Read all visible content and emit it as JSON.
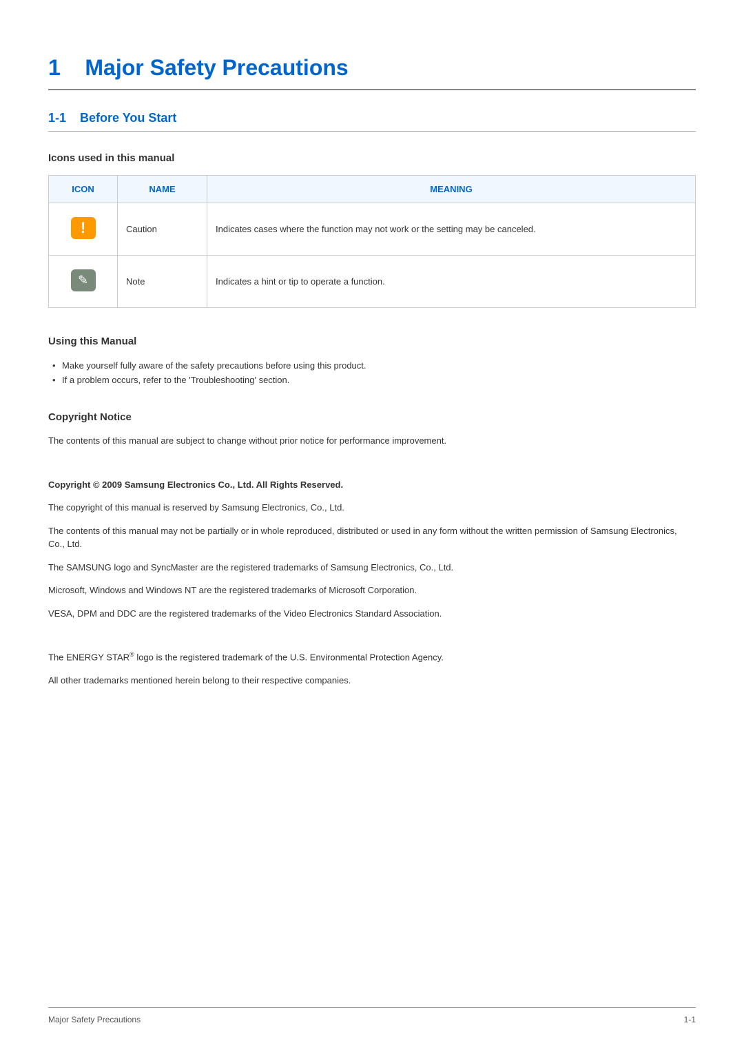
{
  "chapter": {
    "number": "1",
    "title": "Major Safety Precautions"
  },
  "section": {
    "number": "1-1",
    "title": "Before You Start"
  },
  "iconsHeading": "Icons used in this manual",
  "table": {
    "headers": {
      "icon": "ICON",
      "name": "NAME",
      "meaning": "MEANING"
    },
    "rows": [
      {
        "name": "Caution",
        "meaning": "Indicates cases where the function may not work or the setting may be canceled."
      },
      {
        "name": "Note",
        "meaning": "Indicates a hint or tip to operate a function."
      }
    ]
  },
  "usingManual": {
    "heading": "Using this Manual",
    "bullets": [
      "Make yourself fully aware of the safety precautions before using this product.",
      "If a problem occurs, refer to the 'Troubleshooting' section."
    ]
  },
  "copyright": {
    "heading": "Copyright Notice",
    "intro": "The contents of this manual are subject to change without prior notice for performance improvement.",
    "boldline": "Copyright © 2009 Samsung Electronics Co., Ltd. All Rights Reserved.",
    "p1": "The copyright of this manual is reserved by Samsung Electronics, Co., Ltd.",
    "p2": "The contents of this manual may not be partially or in whole reproduced, distributed or used in any form without the written permission of Samsung Electronics, Co., Ltd.",
    "p3": "The SAMSUNG logo and SyncMaster are the registered trademarks of Samsung Electronics, Co., Ltd.",
    "p4": "Microsoft, Windows and Windows NT are the registered trademarks of Microsoft Corporation.",
    "p5": "VESA, DPM and DDC are the registered trademarks of the Video Electronics Standard Association.",
    "p6a": "The ENERGY STAR",
    "p6b": " logo is the registered trademark of the U.S. Environmental Protection Agency.",
    "p7": "All other trademarks mentioned herein belong to their respective companies."
  },
  "footer": {
    "left": "Major Safety Precautions",
    "right": "1-1"
  }
}
